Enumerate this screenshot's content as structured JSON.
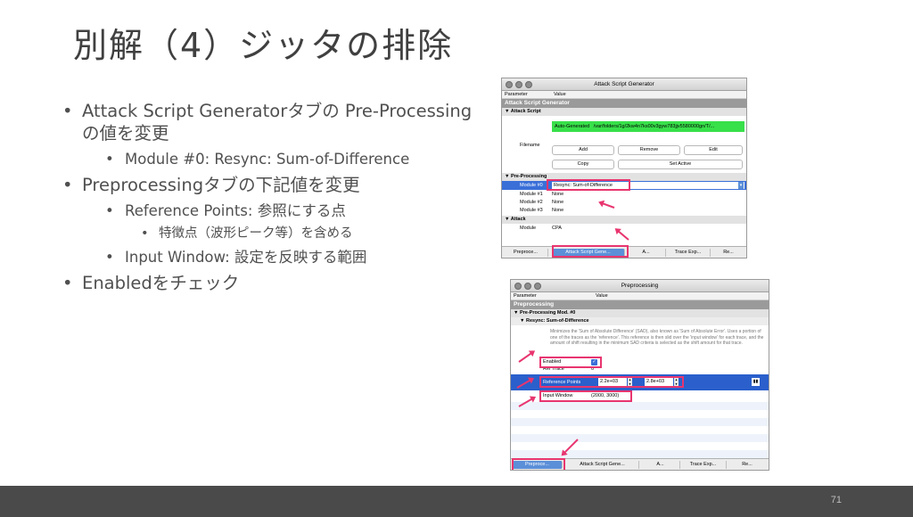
{
  "slide": {
    "title": "別解（4）ジッタの排除",
    "page_number": "71"
  },
  "bullets": {
    "b1": "Attack Script Generatorタブの Pre-Processingの値を変更",
    "b1_1": "Module #0: Resync: Sum-of-Difference",
    "b2": "Preprocessingタブの下記値を変更",
    "b2_1": "Reference Points: 参照にする点",
    "b2_1_1": "特徴点（波形ピーク等）を含める",
    "b2_2": "Input Window: 設定を反映する範囲",
    "b3": "Enabledをチェック"
  },
  "window1": {
    "title": "Attack Script Generator",
    "col_parameter": "Parameter",
    "col_value": "Value",
    "group": "Attack Script Generator",
    "section_attack_script": "Attack Script",
    "auto_generated": "Auto-Generated",
    "path": "/var/folders/1g/2kw4n7ks00v3gyw783jjv5580000gn/T/...",
    "filename_label": "Filename",
    "btn_add": "Add",
    "btn_remove": "Remove",
    "btn_edit": "Edit",
    "btn_copy": "Copy",
    "btn_set_active": "Set Active",
    "section_preprocessing": "Pre-Processing",
    "module0_label": "Module #0",
    "module0_value": "Resync: Sum-of-Difference",
    "module1_label": "Module #1",
    "module1_value": "None",
    "module2_label": "Module #2",
    "module2_value": "None",
    "module3_label": "Module #3",
    "module3_value": "None",
    "section_attack": "Attack",
    "module_label": "Module",
    "module_value": "CPA",
    "tab_preprocessing": "Preproce...",
    "tab_attack_script": "Attack Script Gene...",
    "tab_a": "A...",
    "tab_trace": "Trace Exp...",
    "tab_re": "Re..."
  },
  "window2": {
    "title": "Preprocessing",
    "col_parameter": "Parameter",
    "col_value": "Value",
    "group": "Preprocessing",
    "section_mod": "Pre-Processing Mod. #0",
    "section_resync": "Resync: Sum-of-Difference",
    "description": "Minimizes the 'Sum of Absolute Difference' (SAD), also known as 'Sum of Absolute Error'. Uses a portion of one of the traces as the 'reference'. This reference is then slid over the 'input window' for each trace, and the amount of shift resulting in the minimum SAD criteria is selected as the shift amount for that trace.",
    "enabled_label": "Enabled",
    "ref_trace_label": "Ref Trace",
    "ref_trace_value": "0",
    "ref_points_label": "Reference Points",
    "ref_point_1": "2.2e+03",
    "ref_point_2": "2.8e+03",
    "input_window_label": "Input Window",
    "input_window_value": "(2000, 3000)",
    "tab_preprocessing": "Preproce...",
    "tab_attack_script": "Attack Script Gene...",
    "tab_a": "A...",
    "tab_trace": "Trace Exp...",
    "tab_re": "Re..."
  }
}
